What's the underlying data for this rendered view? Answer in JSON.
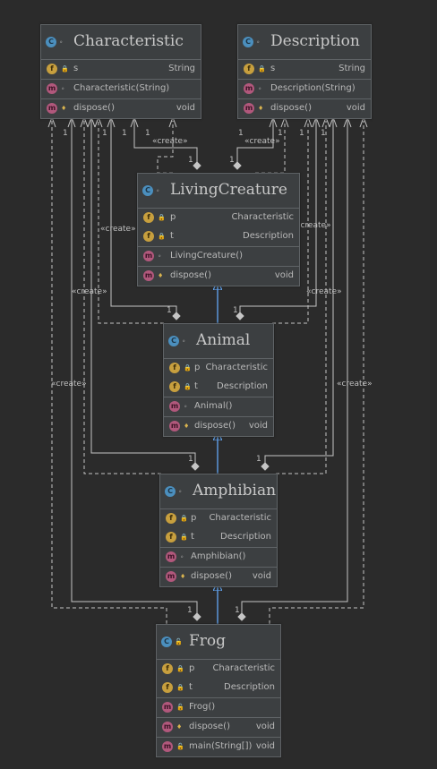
{
  "classes": {
    "characteristic": {
      "name": "Characteristic",
      "field": {
        "name": "s",
        "type": "String"
      },
      "constructor": "Characteristic(String)",
      "method": {
        "name": "dispose()",
        "type": "void"
      }
    },
    "description": {
      "name": "Description",
      "field": {
        "name": "s",
        "type": "String"
      },
      "constructor": "Description(String)",
      "method": {
        "name": "dispose()",
        "type": "void"
      }
    },
    "livingcreature": {
      "name": "LivingCreature",
      "fields": [
        {
          "name": "p",
          "type": "Characteristic"
        },
        {
          "name": "t",
          "type": "Description"
        }
      ],
      "constructor": "LivingCreature()",
      "method": {
        "name": "dispose()",
        "type": "void"
      }
    },
    "animal": {
      "name": "Animal",
      "fields": [
        {
          "name": "p",
          "type": "Characteristic"
        },
        {
          "name": "t",
          "type": "Description"
        }
      ],
      "constructor": "Animal()",
      "method": {
        "name": "dispose()",
        "type": "void"
      }
    },
    "amphibian": {
      "name": "Amphibian",
      "fields": [
        {
          "name": "p",
          "type": "Characteristic"
        },
        {
          "name": "t",
          "type": "Description"
        }
      ],
      "constructor": "Amphibian()",
      "method": {
        "name": "dispose()",
        "type": "void"
      }
    },
    "frog": {
      "name": "Frog",
      "fields": [
        {
          "name": "p",
          "type": "Characteristic"
        },
        {
          "name": "t",
          "type": "Description"
        }
      ],
      "constructor": "Frog()",
      "methods": [
        {
          "name": "dispose()",
          "type": "void"
        },
        {
          "name": "main(String[])",
          "type": "void"
        }
      ]
    }
  },
  "badges": {
    "class": "C",
    "field": "f",
    "method": "m"
  },
  "visibility": {
    "package": "∘",
    "private": "🔒",
    "protected": "♦",
    "public": "🔓"
  },
  "relations": {
    "create_label": "«create»",
    "multiplicity": "1"
  },
  "colors": {
    "background": "#2b2b2b",
    "box": "#3c3f41",
    "line": "#c5c5c5",
    "inheritance": "#5f9ee6"
  }
}
